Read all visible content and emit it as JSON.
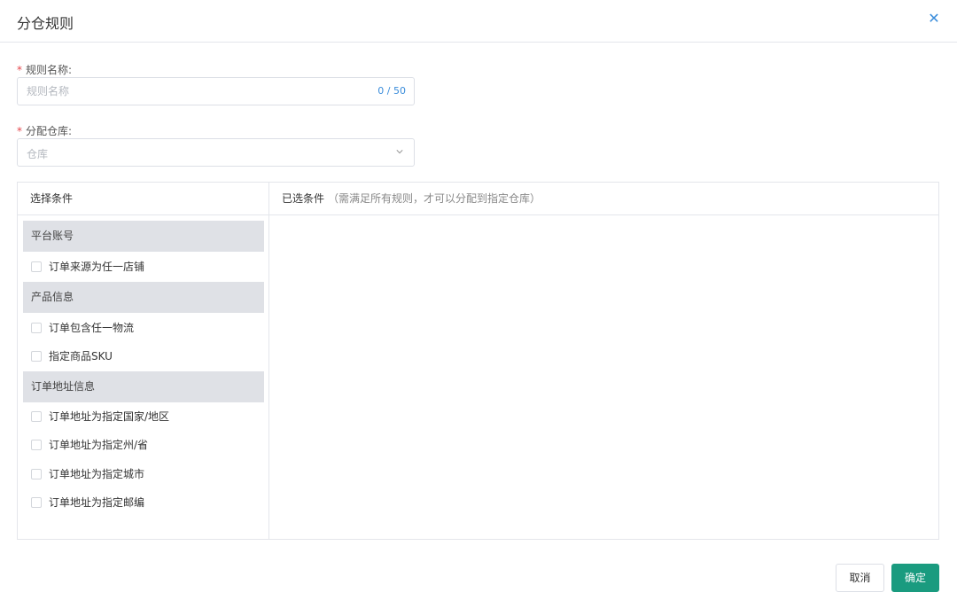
{
  "dialog": {
    "title": "分仓规则",
    "close_icon": "close-icon"
  },
  "form": {
    "rule_name": {
      "required_mark": "*",
      "label": "规则名称:",
      "value": "",
      "placeholder": "规则名称",
      "counter": "0 / 50"
    },
    "warehouse": {
      "required_mark": "*",
      "label": "分配仓库:",
      "placeholder": "仓库",
      "icon": "chevron-down-icon"
    }
  },
  "conditions": {
    "left_title": "选择条件",
    "right_title": "已选条件",
    "right_hint": "（需满足所有规则，才可以分配到指定仓库）",
    "groups": [
      {
        "title": "平台账号",
        "options": [
          {
            "label": "订单来源为任一店铺",
            "checked": false
          }
        ]
      },
      {
        "title": "产品信息",
        "options": [
          {
            "label": "订单包含任一物流",
            "checked": false
          },
          {
            "label": "指定商品SKU",
            "checked": false
          }
        ]
      },
      {
        "title": "订单地址信息",
        "options": [
          {
            "label": "订单地址为指定国家/地区",
            "checked": false
          },
          {
            "label": "订单地址为指定州/省",
            "checked": false
          },
          {
            "label": "订单地址为指定城市",
            "checked": false
          },
          {
            "label": "订单地址为指定邮编",
            "checked": false
          }
        ]
      }
    ]
  },
  "footer": {
    "cancel_label": "取消",
    "confirm_label": "确定"
  },
  "colors": {
    "primary": "#1a9b7f",
    "link": "#3b8ddb",
    "required": "#e5484d",
    "group_bg": "#dfe1e6"
  }
}
